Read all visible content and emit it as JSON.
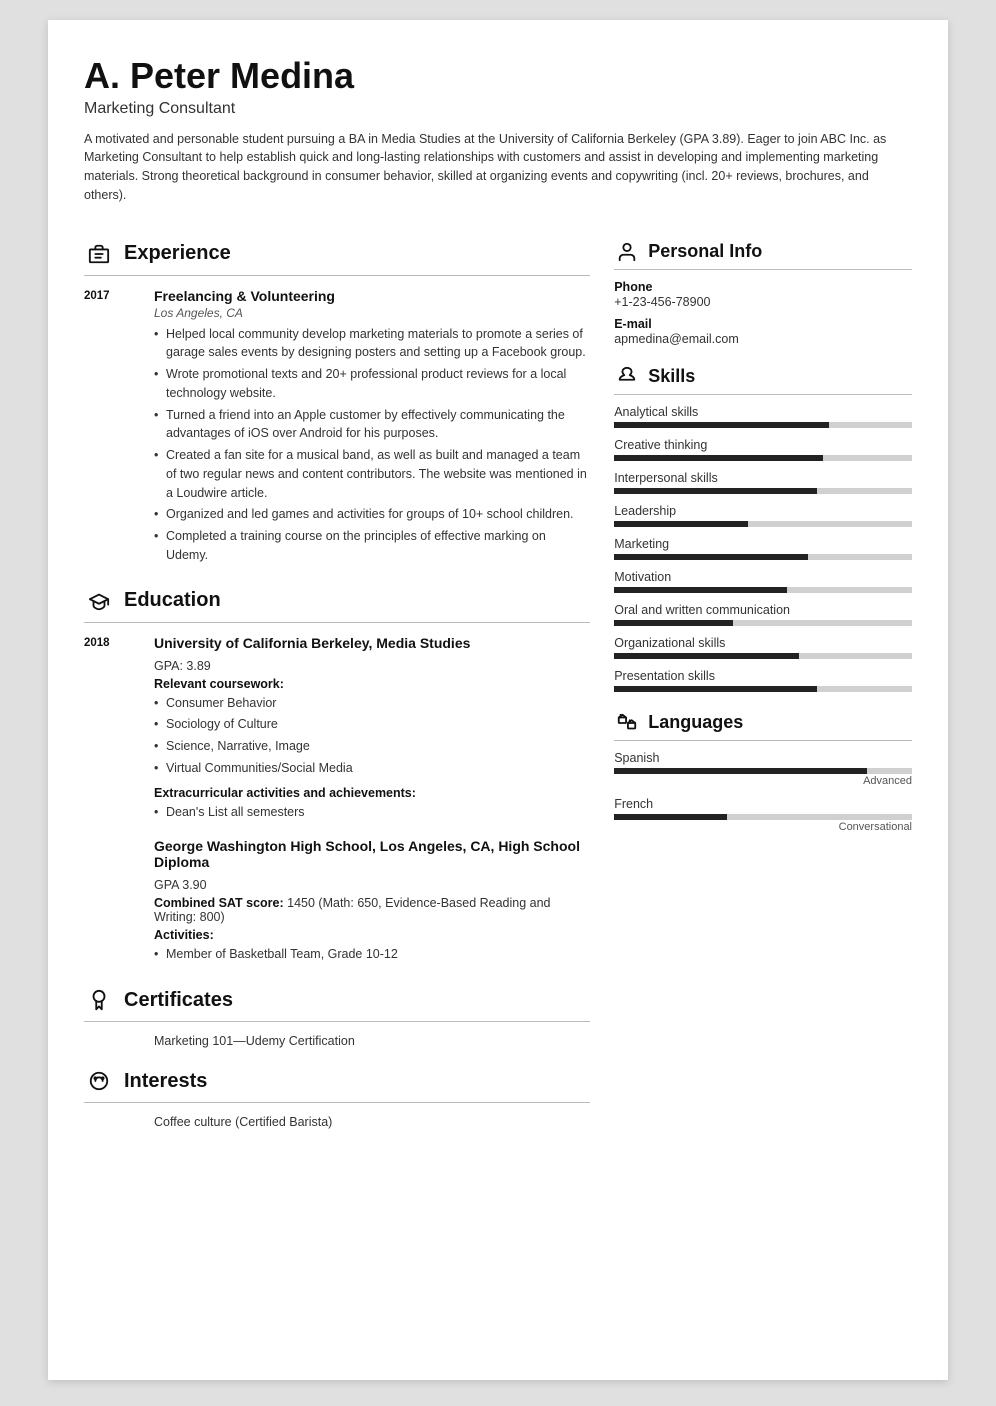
{
  "header": {
    "name": "A. Peter Medina",
    "job_title": "Marketing Consultant",
    "summary": "A motivated and personable student pursuing a BA in Media Studies at the University of California Berkeley (GPA 3.89). Eager to join ABC Inc. as Marketing Consultant to help establish quick and long-lasting relationships with customers and assist in developing and implementing marketing materials. Strong theoretical background in consumer behavior, skilled at organizing events and copywriting (incl. 20+ reviews, brochures, and others)."
  },
  "sections": {
    "experience": {
      "title": "Experience",
      "entries": [
        {
          "year": "2017",
          "title": "Freelancing & Volunteering",
          "subtitle": "Los Angeles, CA",
          "bullets": [
            "Helped local community develop marketing materials to promote a series of garage sales events by designing posters and setting up a Facebook group.",
            "Wrote promotional texts and 20+ professional product reviews for a local technology website.",
            "Turned a friend into an Apple customer by effectively communicating the advantages of iOS over Android for his purposes.",
            "Created a fan site for a musical band, as well as built and managed a team of two regular news and content contributors. The website was mentioned in a Loudwire article.",
            "Organized and led games and activities for groups of 10+ school children.",
            "Completed a training course on the principles of effective marking on Udemy."
          ]
        }
      ]
    },
    "education": {
      "title": "Education",
      "entries": [
        {
          "year": "2018",
          "title": "University of California Berkeley, Media Studies",
          "subtitle": "",
          "gpa": "GPA: 3.89",
          "coursework_label": "Relevant coursework:",
          "coursework": [
            "Consumer Behavior",
            "Sociology of Culture",
            "Science, Narrative, Image",
            "Virtual Communities/Social Media"
          ],
          "extracurricular_label": "Extracurricular activities and achievements:",
          "extracurricular": [
            "Dean's List all semesters"
          ]
        },
        {
          "year": "",
          "title": "George Washington High School, Los Angeles, CA, High School Diploma",
          "subtitle": "",
          "gpa": "GPA 3.90",
          "sat_label": "Combined SAT score:",
          "sat_value": "1450 (Math: 650, Evidence-Based Reading and Writing: 800)",
          "activities_label": "Activities:",
          "activities": [
            "Member of Basketball Team, Grade 10-12"
          ]
        }
      ]
    },
    "certificates": {
      "title": "Certificates",
      "items": [
        "Marketing 101—Udemy Certification"
      ]
    },
    "interests": {
      "title": "Interests",
      "items": [
        "Coffee culture (Certified Barista)"
      ]
    }
  },
  "right": {
    "personal_info": {
      "title": "Personal Info",
      "phone_label": "Phone",
      "phone": "+1-23-456-78900",
      "email_label": "E-mail",
      "email": "apmedina@email.com"
    },
    "skills": {
      "title": "Skills",
      "items": [
        {
          "name": "Analytical skills",
          "pct": 72
        },
        {
          "name": "Creative thinking",
          "pct": 70
        },
        {
          "name": "Interpersonal skills",
          "pct": 68
        },
        {
          "name": "Leadership",
          "pct": 45
        },
        {
          "name": "Marketing",
          "pct": 65
        },
        {
          "name": "Motivation",
          "pct": 58
        },
        {
          "name": "Oral and written communication",
          "pct": 40
        },
        {
          "name": "Organizational skills",
          "pct": 62
        },
        {
          "name": "Presentation skills",
          "pct": 68
        }
      ]
    },
    "languages": {
      "title": "Languages",
      "items": [
        {
          "name": "Spanish",
          "pct": 85,
          "level": "Advanced"
        },
        {
          "name": "French",
          "pct": 38,
          "level": "Conversational"
        }
      ]
    }
  }
}
